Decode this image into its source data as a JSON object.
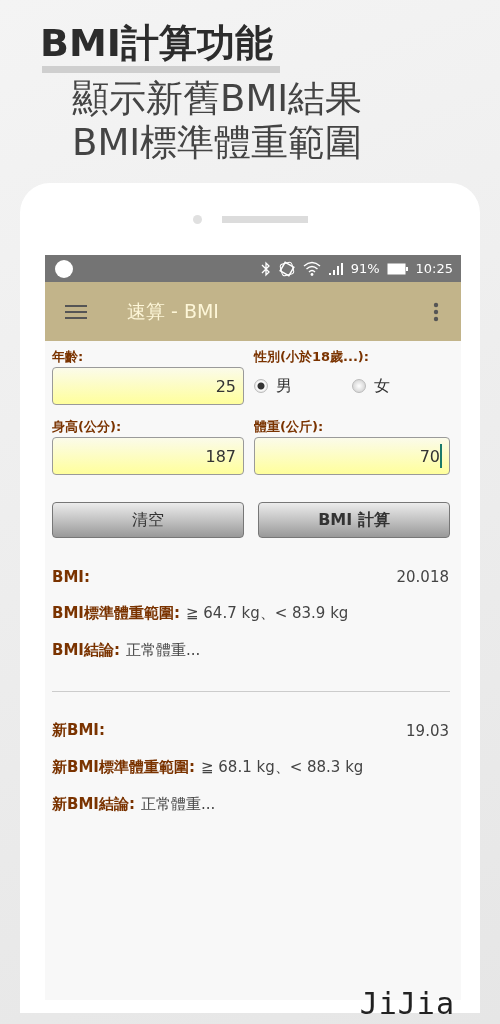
{
  "headline": "BMI計算功能",
  "subtitle_lines": [
    "顯示新舊BMI結果",
    "BMI標準體重範圍"
  ],
  "status_bar": {
    "battery": "91%",
    "time": "10:25"
  },
  "app_bar": {
    "title": "速算 - BMI"
  },
  "form": {
    "age": {
      "label": "年齡:",
      "value": "25",
      "focused": false
    },
    "gender": {
      "label": "性別(小於18歲...):",
      "options": [
        {
          "label": "男",
          "selected": true
        },
        {
          "label": "女",
          "selected": false
        }
      ]
    },
    "height": {
      "label": "身高(公分):",
      "value": "187",
      "focused": false
    },
    "weight": {
      "label": "體重(公斤):",
      "value": "70",
      "focused": true
    }
  },
  "buttons": [
    {
      "label": "清空",
      "bold": false
    },
    {
      "label": "BMI 計算",
      "bold": true
    }
  ],
  "results": [
    {
      "bmi_label": "BMI:",
      "bmi": "20.018",
      "range_label": "BMI標準體重範圍:",
      "range": "≧ 64.7 kg、< 83.9 kg",
      "conclusion_label": "BMI結論:",
      "conclusion": "正常體重..."
    },
    {
      "bmi_label": "新BMI:",
      "bmi": "19.03",
      "range_label": "新BMI標準體重範圍:",
      "range": "≧ 68.1 kg、< 88.3 kg",
      "conclusion_label": "新BMI結論:",
      "conclusion": "正常體重..."
    }
  ],
  "logo": "JiJia"
}
